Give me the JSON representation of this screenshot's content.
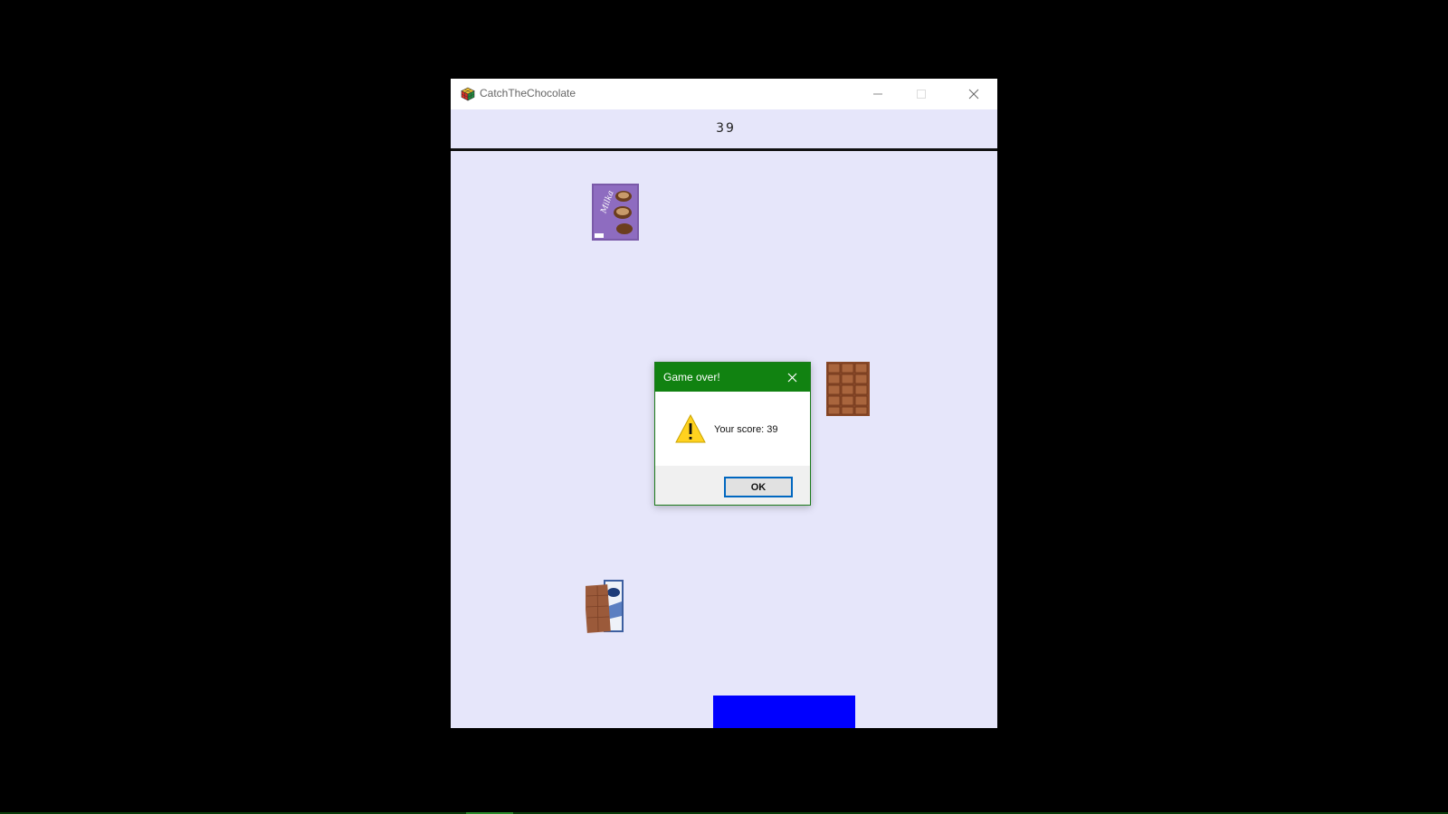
{
  "window": {
    "title": "CatchTheChocolate",
    "icon": "rubiks-cube-icon",
    "controls": {
      "minimize": "minimize-icon",
      "maximize": "maximize-icon",
      "close": "close-icon"
    },
    "background_color": "#e6e6fa"
  },
  "game": {
    "score": "39",
    "paddle_color": "#0000ff",
    "items": [
      "milka-box",
      "chocolate-bar",
      "lindt-bar"
    ]
  },
  "dialog": {
    "title": "Game over!",
    "message": "Your score: 39",
    "ok_label": "OK",
    "icon": "warning-icon",
    "title_color": "#118211"
  }
}
